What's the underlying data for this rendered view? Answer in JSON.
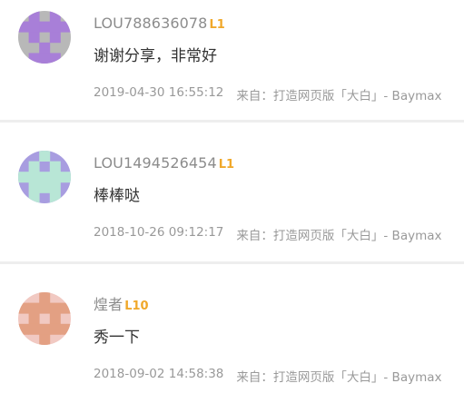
{
  "comments": [
    {
      "username": "LOU788636078",
      "level": "L1",
      "text": "谢谢分享，非常好",
      "time": "2019-04-30 16:55:12",
      "source_prefix": "来自：",
      "source": "打造网页版「大白」- Baymax",
      "avatar": {
        "bg": "#b8b8b8",
        "fg": "#a87fd8"
      }
    },
    {
      "username": "LOU1494526454",
      "level": "L1",
      "text": "棒棒哒",
      "time": "2018-10-26 09:12:17",
      "source_prefix": "来自：",
      "source": "打造网页版「大白」- Baymax",
      "avatar": {
        "bg": "#a89de0",
        "fg": "#b8e6d6"
      }
    },
    {
      "username": "煌者",
      "level": "L10",
      "text": "秀一下",
      "time": "2018-09-02 14:58:38",
      "source_prefix": "来自：",
      "source": "打造网页版「大白」- Baymax",
      "avatar": {
        "bg": "#f1c9c2",
        "fg": "#e3a083"
      }
    }
  ],
  "colors": {
    "username": "#8c8c8c",
    "level": "#f0a82a",
    "text": "#333333",
    "footer": "#999999",
    "separator": "#eeeeee"
  }
}
